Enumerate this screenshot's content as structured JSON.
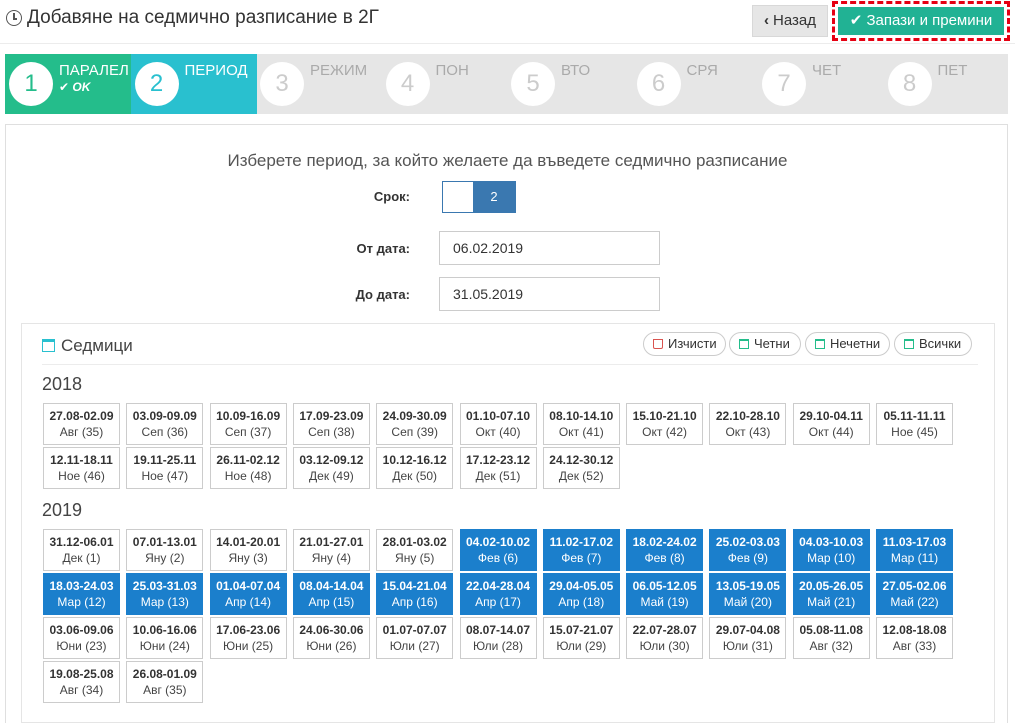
{
  "header": {
    "title": "Добавяне на седмично разписание в 2Г",
    "back_label": "Назад",
    "save_label": "Запази и премини"
  },
  "wizard": {
    "steps": [
      {
        "num": "1",
        "label": "ПАРАЛЕЛ",
        "status": "done",
        "ok": "OK"
      },
      {
        "num": "2",
        "label": "ПЕРИОД",
        "status": "active"
      },
      {
        "num": "3",
        "label": "РЕЖИМ",
        "status": "pending"
      },
      {
        "num": "4",
        "label": "ПОН",
        "status": "pending"
      },
      {
        "num": "5",
        "label": "ВТО",
        "status": "pending"
      },
      {
        "num": "6",
        "label": "СРЯ",
        "status": "pending"
      },
      {
        "num": "7",
        "label": "ЧЕТ",
        "status": "pending"
      },
      {
        "num": "8",
        "label": "ПЕТ",
        "status": "pending"
      }
    ]
  },
  "form": {
    "prompt": "Изберете период, за който желаете да въведете седмично разписание",
    "term_label": "Срок:",
    "term_value": "2",
    "from_label": "От дата:",
    "from_value": "06.02.2019",
    "to_label": "До дата:",
    "to_value": "31.05.2019"
  },
  "weeks": {
    "title": "Седмици",
    "actions": {
      "clear": "Изчисти",
      "even": "Четни",
      "odd": "Нечетни",
      "all": "Всички"
    },
    "years": [
      {
        "year": "2018",
        "items": [
          {
            "range": "27.08-02.09",
            "month": "Авг (35)",
            "selected": false
          },
          {
            "range": "03.09-09.09",
            "month": "Сеп (36)",
            "selected": false
          },
          {
            "range": "10.09-16.09",
            "month": "Сеп (37)",
            "selected": false
          },
          {
            "range": "17.09-23.09",
            "month": "Сеп (38)",
            "selected": false
          },
          {
            "range": "24.09-30.09",
            "month": "Сеп (39)",
            "selected": false
          },
          {
            "range": "01.10-07.10",
            "month": "Окт (40)",
            "selected": false
          },
          {
            "range": "08.10-14.10",
            "month": "Окт (41)",
            "selected": false
          },
          {
            "range": "15.10-21.10",
            "month": "Окт (42)",
            "selected": false
          },
          {
            "range": "22.10-28.10",
            "month": "Окт (43)",
            "selected": false
          },
          {
            "range": "29.10-04.11",
            "month": "Окт (44)",
            "selected": false
          },
          {
            "range": "05.11-11.11",
            "month": "Ное (45)",
            "selected": false
          },
          {
            "range": "12.11-18.11",
            "month": "Ное (46)",
            "selected": false
          },
          {
            "range": "19.11-25.11",
            "month": "Ное (47)",
            "selected": false
          },
          {
            "range": "26.11-02.12",
            "month": "Ное (48)",
            "selected": false
          },
          {
            "range": "03.12-09.12",
            "month": "Дек (49)",
            "selected": false
          },
          {
            "range": "10.12-16.12",
            "month": "Дек (50)",
            "selected": false
          },
          {
            "range": "17.12-23.12",
            "month": "Дек (51)",
            "selected": false
          },
          {
            "range": "24.12-30.12",
            "month": "Дек (52)",
            "selected": false
          }
        ]
      },
      {
        "year": "2019",
        "items": [
          {
            "range": "31.12-06.01",
            "month": "Дек (1)",
            "selected": false
          },
          {
            "range": "07.01-13.01",
            "month": "Яну (2)",
            "selected": false
          },
          {
            "range": "14.01-20.01",
            "month": "Яну (3)",
            "selected": false
          },
          {
            "range": "21.01-27.01",
            "month": "Яну (4)",
            "selected": false
          },
          {
            "range": "28.01-03.02",
            "month": "Яну (5)",
            "selected": false
          },
          {
            "range": "04.02-10.02",
            "month": "Фев (6)",
            "selected": true
          },
          {
            "range": "11.02-17.02",
            "month": "Фев (7)",
            "selected": true
          },
          {
            "range": "18.02-24.02",
            "month": "Фев (8)",
            "selected": true
          },
          {
            "range": "25.02-03.03",
            "month": "Фев (9)",
            "selected": true
          },
          {
            "range": "04.03-10.03",
            "month": "Мар (10)",
            "selected": true
          },
          {
            "range": "11.03-17.03",
            "month": "Мар (11)",
            "selected": true
          },
          {
            "range": "18.03-24.03",
            "month": "Мар (12)",
            "selected": true
          },
          {
            "range": "25.03-31.03",
            "month": "Мар (13)",
            "selected": true
          },
          {
            "range": "01.04-07.04",
            "month": "Апр (14)",
            "selected": true
          },
          {
            "range": "08.04-14.04",
            "month": "Апр (15)",
            "selected": true
          },
          {
            "range": "15.04-21.04",
            "month": "Апр (16)",
            "selected": true
          },
          {
            "range": "22.04-28.04",
            "month": "Апр (17)",
            "selected": true
          },
          {
            "range": "29.04-05.05",
            "month": "Апр (18)",
            "selected": true
          },
          {
            "range": "06.05-12.05",
            "month": "Май (19)",
            "selected": true
          },
          {
            "range": "13.05-19.05",
            "month": "Май (20)",
            "selected": true
          },
          {
            "range": "20.05-26.05",
            "month": "Май (21)",
            "selected": true
          },
          {
            "range": "27.05-02.06",
            "month": "Май (22)",
            "selected": true
          },
          {
            "range": "03.06-09.06",
            "month": "Юни (23)",
            "selected": false
          },
          {
            "range": "10.06-16.06",
            "month": "Юни (24)",
            "selected": false
          },
          {
            "range": "17.06-23.06",
            "month": "Юни (25)",
            "selected": false
          },
          {
            "range": "24.06-30.06",
            "month": "Юни (26)",
            "selected": false
          },
          {
            "range": "01.07-07.07",
            "month": "Юли (27)",
            "selected": false
          },
          {
            "range": "08.07-14.07",
            "month": "Юли (28)",
            "selected": false
          },
          {
            "range": "15.07-21.07",
            "month": "Юли (29)",
            "selected": false
          },
          {
            "range": "22.07-28.07",
            "month": "Юли (30)",
            "selected": false
          },
          {
            "range": "29.07-04.08",
            "month": "Юли (31)",
            "selected": false
          },
          {
            "range": "05.08-11.08",
            "month": "Авг (32)",
            "selected": false
          },
          {
            "range": "12.08-18.08",
            "month": "Авг (33)",
            "selected": false
          },
          {
            "range": "19.08-25.08",
            "month": "Авг (34)",
            "selected": false
          },
          {
            "range": "26.08-01.09",
            "month": "Авг (35)",
            "selected": false
          }
        ]
      }
    ]
  },
  "colors": {
    "done": "#24bd8b",
    "active": "#29c0cf",
    "selected_week": "#1b7fcc",
    "highlight_border": "#e60012"
  }
}
